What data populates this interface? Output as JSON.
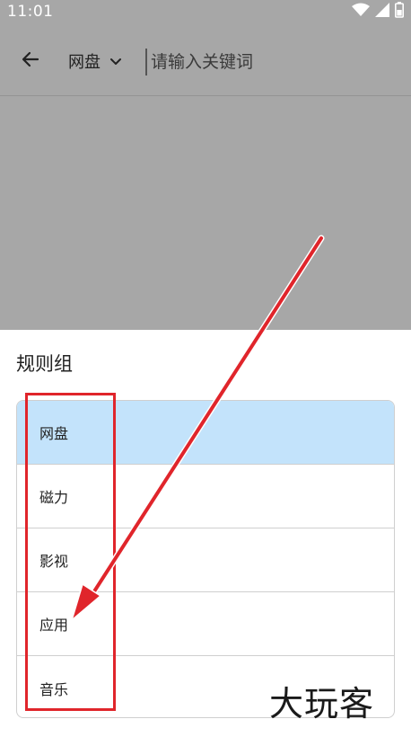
{
  "status_bar": {
    "time": "11:01",
    "icons": [
      "wifi-icon",
      "signal-icon",
      "battery-icon"
    ]
  },
  "toolbar": {
    "category_label": "网盘",
    "search_placeholder": "请输入关键词"
  },
  "sheet": {
    "title": "规则组",
    "items": [
      {
        "label": "网盘",
        "selected": true
      },
      {
        "label": "磁力",
        "selected": false
      },
      {
        "label": "影视",
        "selected": false
      },
      {
        "label": "应用",
        "selected": false
      },
      {
        "label": "音乐",
        "selected": false
      }
    ]
  },
  "watermark": "大玩客",
  "colors": {
    "scrim": "#a7a7a7",
    "selected_row": "#c3e3fb",
    "annotation_red": "#e0252b"
  }
}
